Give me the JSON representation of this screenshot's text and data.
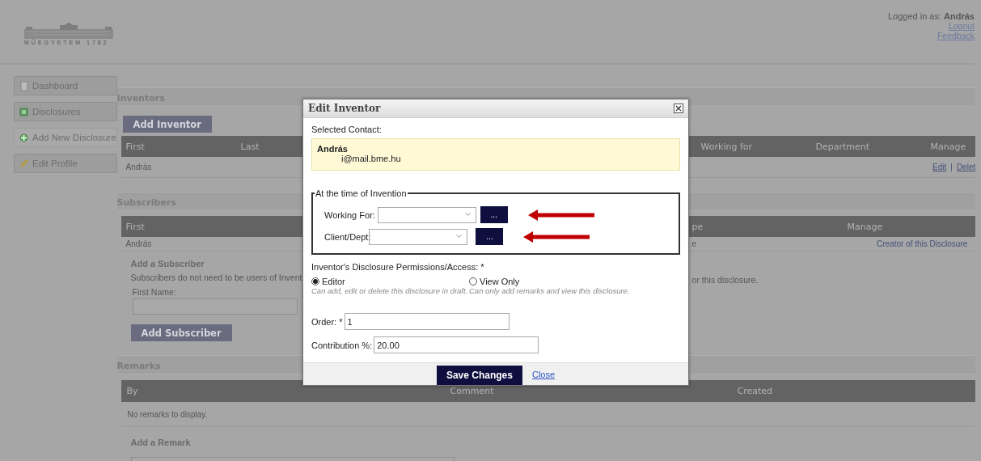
{
  "header": {
    "logo_text": "MŰEGYETEM 1782",
    "logged_in_label": "Logged in as:",
    "user": "András",
    "links": [
      "Logout",
      "Feedback"
    ]
  },
  "sidebar": {
    "items": [
      {
        "label": "Dashboard",
        "selected": false
      },
      {
        "label": "Disclosures",
        "selected": false
      },
      {
        "label": "Add New Disclosure",
        "selected": true
      },
      {
        "label": "Edit Profile",
        "selected": false
      }
    ]
  },
  "inventors": {
    "title": "Inventors",
    "add_button": "Add Inventor",
    "columns_left": [
      "First",
      "Last"
    ],
    "columns_right": [
      "Working for",
      "Department",
      "Manage"
    ],
    "rows": [
      {
        "first": "András",
        "actions": [
          "Edit",
          "Delet"
        ],
        "separator": "|"
      }
    ]
  },
  "subscribers": {
    "title": "Subscribers",
    "columns_left": [
      "First"
    ],
    "columns_right": [
      "pe",
      "Manage"
    ],
    "rows": [
      {
        "first": "András",
        "column_2": "e",
        "manage": "Creator of this Disclosure"
      }
    ],
    "add": {
      "title": "Add a Subscriber",
      "note_left": "Subscribers do not need to be users of Invent",
      "note_right": "or this disclosure.",
      "first_name_label": "First Name:",
      "button": "Add Subscriber"
    }
  },
  "remarks": {
    "title": "Remarks",
    "columns": [
      "By",
      "Comment",
      "Created"
    ],
    "empty": "No remarks to display.",
    "add_title": "Add a Remark"
  },
  "dialog": {
    "title": "Edit Inventor",
    "selected_contact_label": "Selected Contact:",
    "contact": {
      "name": "András",
      "email": "i@mail.bme.hu"
    },
    "fieldset": {
      "legend": "At the time of Invention",
      "fields": [
        {
          "label": "Working For:",
          "button": "..."
        },
        {
          "label": "Client/Dept:",
          "button": "..."
        }
      ]
    },
    "permissions": {
      "label": "Inventor's Disclosure Permissions/Access: *",
      "options": [
        {
          "label": "Editor",
          "description": "Can add, edit or delete this disclosure in draft.",
          "selected": true
        },
        {
          "label": "View Only",
          "description": "Can only add remarks and view this disclosure.",
          "selected": false
        }
      ]
    },
    "order": {
      "label": "Order: *",
      "value": "1"
    },
    "contribution": {
      "label": "Contribution %:",
      "value": "20.00"
    },
    "save_button": "Save Changes",
    "close_link": "Close"
  }
}
